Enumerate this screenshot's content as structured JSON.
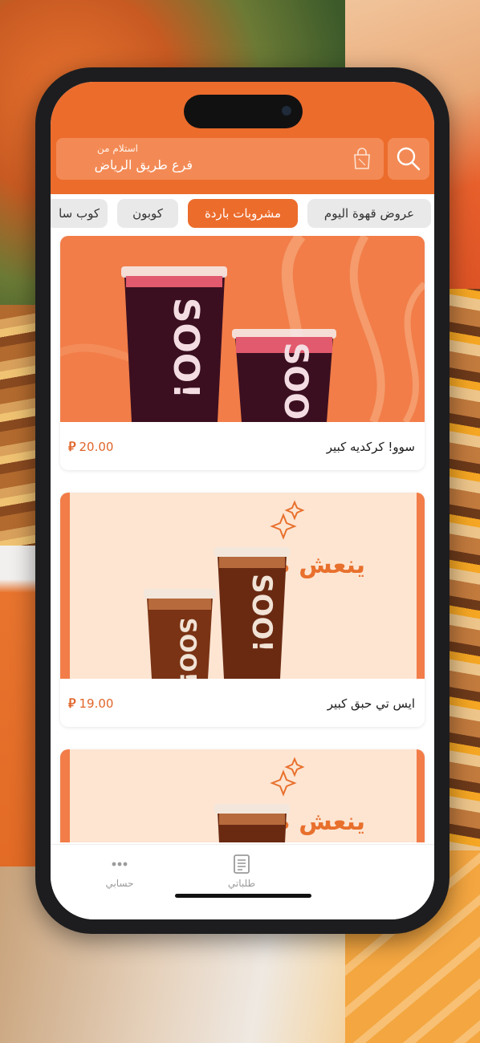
{
  "header": {
    "pickup_label": "استلام من",
    "branch_name": "فرع طريق الرياض"
  },
  "icons": {
    "bag": "shopping-bag-icon",
    "search": "search-icon",
    "orders": "receipt-icon",
    "account": "more-dots-icon"
  },
  "tabs": [
    {
      "label": "عروض قهوة اليوم",
      "active": false
    },
    {
      "label": "مشروبات باردة",
      "active": true
    },
    {
      "label": "كوبون",
      "active": false
    },
    {
      "label": "كوب سا",
      "active": false
    }
  ],
  "products": [
    {
      "name": "سوو! كركديه كبير",
      "price": "20.00",
      "currency_symbol": "⃁"
    },
    {
      "name": "ايس تي حبق كبير",
      "price": "19.00",
      "currency_symbol": "⃁"
    },
    {
      "name": "",
      "price": "",
      "currency_symbol": ""
    }
  ],
  "banners": {
    "promo_text": "ينعش صيفك",
    "cup_brand": "SOO!"
  },
  "nav": {
    "orders_label": "طلباتي",
    "account_label": "حسابي"
  },
  "colors": {
    "brand": "#ec6c2c",
    "price": "#e0652a"
  }
}
